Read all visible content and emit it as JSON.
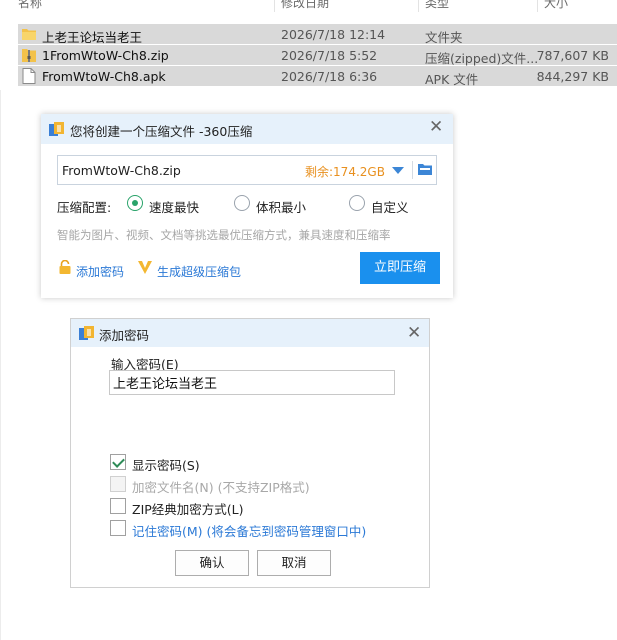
{
  "file_list": {
    "headers": {
      "name": "名称",
      "date": "修改日期",
      "type": "类型",
      "size": "大小"
    },
    "rows": [
      {
        "name": "上老王论坛当老王",
        "date": "2026/7/18 12:14",
        "type": "文件夹",
        "size": "",
        "icon": "folder-icon",
        "selected": true
      },
      {
        "name": "1FromWtoW-Ch8.zip",
        "date": "2026/7/18 5:52",
        "type": "压缩(zipped)文件...",
        "size": "787,607 KB",
        "icon": "zip-icon",
        "selected": true
      },
      {
        "name": "FromWtoW-Ch8.apk",
        "date": "2026/7/18 6:36",
        "type": "APK 文件",
        "size": "844,297 KB",
        "icon": "file-icon",
        "selected": true
      }
    ]
  },
  "compress_dialog": {
    "title": "您将创建一个压缩文件 -360压缩",
    "filename": "FromWtoW-Ch8.zip",
    "free_space": "剩余:174.2GB",
    "config_label": "压缩配置:",
    "options": [
      {
        "label": "速度最快",
        "selected": true
      },
      {
        "label": "体积最小",
        "selected": false
      },
      {
        "label": "自定义",
        "selected": false
      }
    ],
    "hint": "智能为图片、视频、文档等挑选最优压缩方式，兼具速度和压缩率",
    "add_password_link": "添加密码",
    "super_compress_link": "生成超级压缩包",
    "compress_button": "立即压缩",
    "accent_color": "#1a90ee"
  },
  "password_dialog": {
    "title": "添加密码",
    "input_label": "输入密码(E)",
    "password_value": "上老王论坛当老王",
    "checkboxes": [
      {
        "label": "显示密码(S)",
        "checked": true,
        "disabled": false
      },
      {
        "label": "加密文件名(N) (不支持ZIP格式)",
        "checked": false,
        "disabled": true
      },
      {
        "label": "ZIP经典加密方式(L)",
        "checked": false,
        "disabled": false
      },
      {
        "label": "记住密码(M) (将会备忘到密码管理窗口中)",
        "checked": false,
        "disabled": false
      }
    ],
    "ok_button": "确认",
    "cancel_button": "取消"
  }
}
